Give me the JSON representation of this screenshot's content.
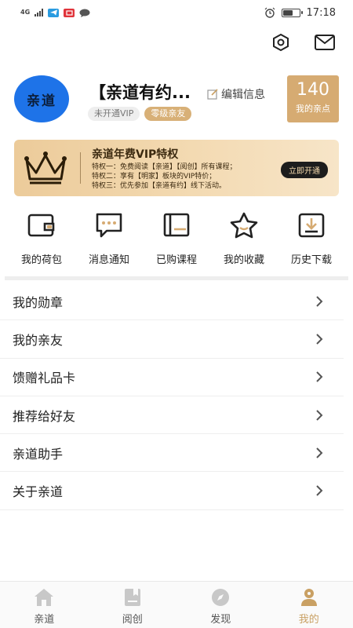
{
  "status_bar": {
    "network": "4G",
    "time": "17:18",
    "battery_level": 0.6
  },
  "top_actions": {
    "icons": [
      "settings-hex-icon",
      "mail-icon"
    ]
  },
  "profile": {
    "avatar_text": "亲道",
    "name": "【亲道有约...",
    "edit_label": "编辑信息",
    "tags": [
      "未开通VIP",
      "零级亲友"
    ],
    "points_value": "140",
    "points_label": "我的亲点",
    "colors": {
      "avatar_bg": "#1e73e8",
      "accent": "#d6ab72"
    }
  },
  "vip_banner": {
    "title": "亲道年费VIP特权",
    "lines": [
      "特权一：免费阅读【亲道】【阅创】所有课程；",
      "特权二：享有【明家】板块的VIP特价；",
      "特权三：优先参加【亲道有约】线下活动。"
    ],
    "button_label": "立即开通",
    "icon": "crown-icon"
  },
  "quick_actions": [
    {
      "label": "我的荷包",
      "icon": "wallet-icon"
    },
    {
      "label": "消息通知",
      "icon": "message-icon"
    },
    {
      "label": "已购课程",
      "icon": "book-icon"
    },
    {
      "label": "我的收藏",
      "icon": "star-icon"
    },
    {
      "label": "历史下载",
      "icon": "download-icon"
    }
  ],
  "menu": [
    {
      "label": "我的勋章"
    },
    {
      "label": "我的亲友"
    },
    {
      "label": "馈赠礼品卡"
    },
    {
      "label": "推荐给好友"
    },
    {
      "label": "亲道助手"
    },
    {
      "label": "关于亲道"
    }
  ],
  "tabbar": [
    {
      "label": "亲道",
      "icon": "home-icon",
      "active": false
    },
    {
      "label": "阅创",
      "icon": "bookmark-book-icon",
      "active": false
    },
    {
      "label": "发现",
      "icon": "compass-icon",
      "active": false
    },
    {
      "label": "我的",
      "icon": "person-icon",
      "active": true
    }
  ]
}
